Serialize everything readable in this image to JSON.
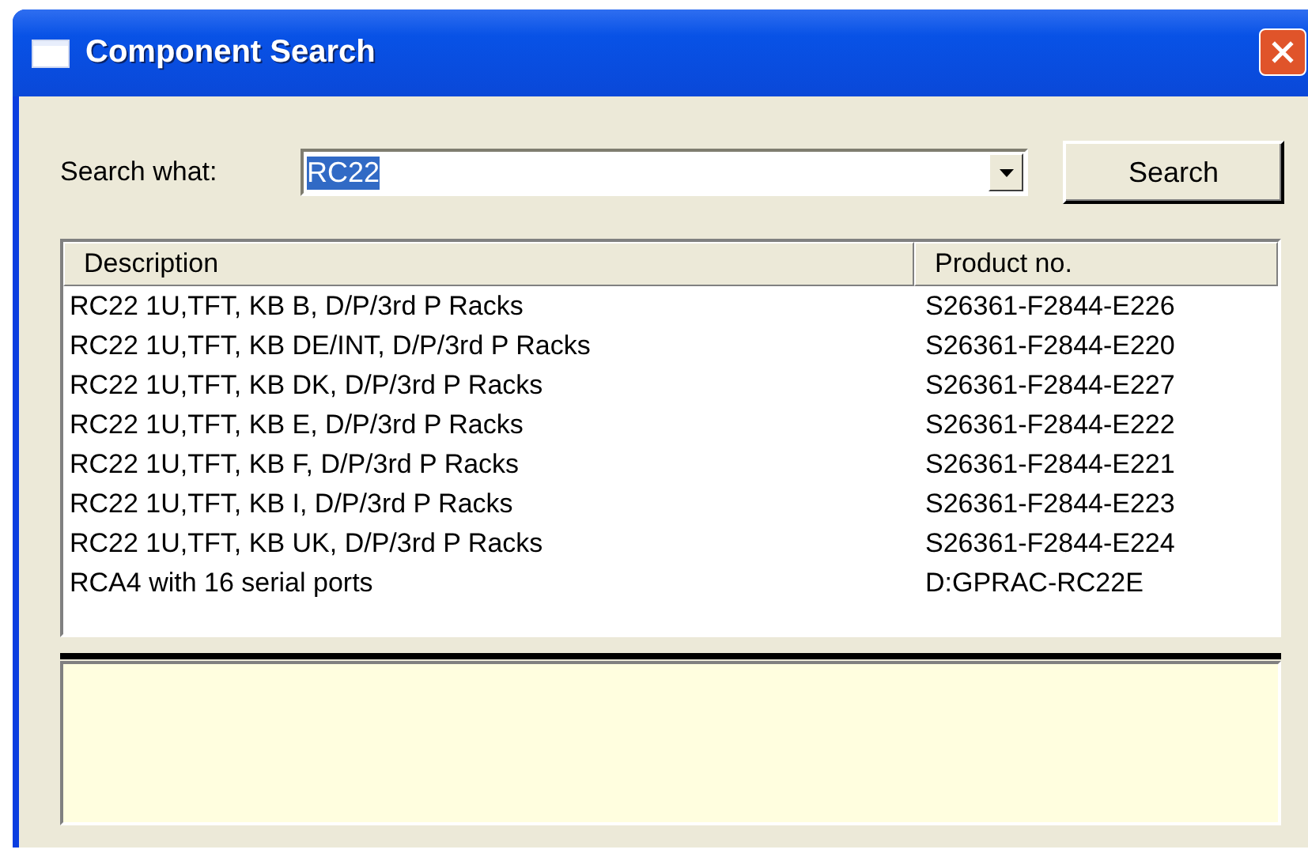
{
  "window": {
    "title": "Component Search"
  },
  "search": {
    "label": "Search what:",
    "value": "RC22",
    "text_selected": true,
    "button": "Search"
  },
  "table": {
    "columns": [
      "Description",
      "Product no."
    ],
    "rows": [
      {
        "cells": [
          "RC22 1U,TFT, KB B, D/P/3rd P Racks",
          "S26361-F2844-E226"
        ]
      },
      {
        "cells": [
          "RC22 1U,TFT, KB DE/INT, D/P/3rd P Racks",
          "S26361-F2844-E220"
        ]
      },
      {
        "cells": [
          "RC22 1U,TFT, KB DK, D/P/3rd P Racks",
          "S26361-F2844-E227"
        ]
      },
      {
        "cells": [
          "RC22 1U,TFT, KB E, D/P/3rd P Racks",
          "S26361-F2844-E222"
        ]
      },
      {
        "cells": [
          "RC22 1U,TFT, KB F, D/P/3rd P Racks",
          "S26361-F2844-E221"
        ]
      },
      {
        "cells": [
          "RC22 1U,TFT, KB I, D/P/3rd P Racks",
          "S26361-F2844-E223"
        ]
      },
      {
        "cells": [
          "RC22 1U,TFT, KB UK, D/P/3rd P Racks",
          "S26361-F2844-E224"
        ]
      },
      {
        "cells": [
          "RCA4 with 16 serial ports",
          "D:GPRAC-RC22E"
        ]
      }
    ]
  }
}
